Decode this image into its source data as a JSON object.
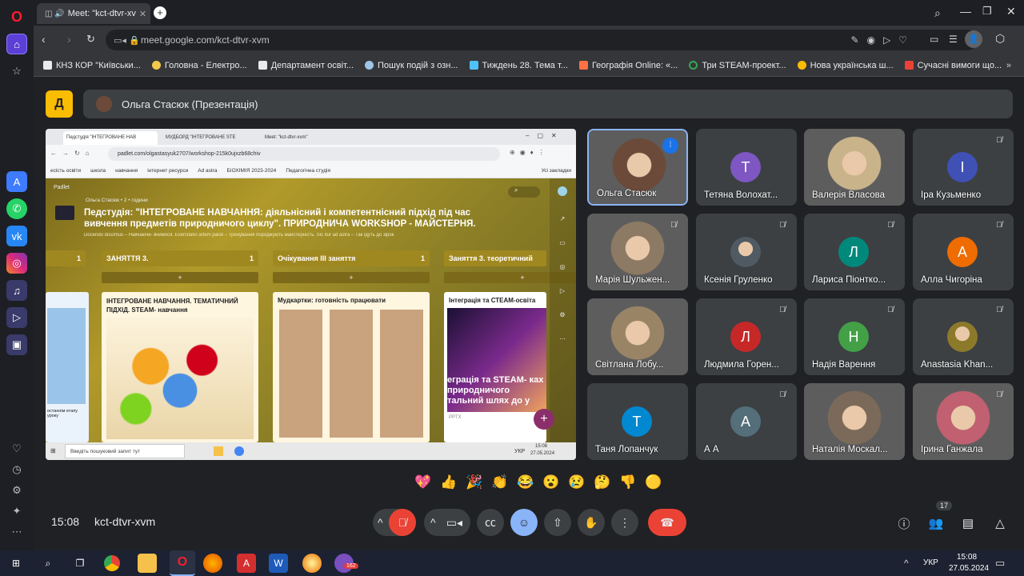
{
  "browser": {
    "tab_title": "Meet: \"kct-dtvr-xv",
    "url": "meet.google.com/kct-dtvr-xvm",
    "bookmarks": [
      {
        "label": "КНЗ КОР \"Київськи...",
        "color": "#e8eaed"
      },
      {
        "label": "Головна - Електро...",
        "color": "#f2c94c"
      },
      {
        "label": "Департамент освіт...",
        "color": "#e8eaed"
      },
      {
        "label": "Пошук подій з озн...",
        "color": "#9fc5e8"
      },
      {
        "label": "Тиждень 28. Тема т...",
        "color": "#4fc3f7"
      },
      {
        "label": "Географія Online: «...",
        "color": "#ff7043"
      },
      {
        "label": "Три STEAM-проект...",
        "color": "#34a853"
      },
      {
        "label": "Нова українська ш...",
        "color": "#fbbc04"
      },
      {
        "label": "Сучасні вимоги що...",
        "color": "#ea4335"
      }
    ]
  },
  "meet": {
    "presenter_label": "Ольга Стасюк (Презентація)",
    "time": "15:08",
    "meeting_code": "kct-dtvr-xvm",
    "people_count": "17",
    "participants": [
      {
        "name": "Ольга Стасюк",
        "initial": "",
        "color": "#6b4a3a",
        "muted": false,
        "photo": true
      },
      {
        "name": "Тетяна Волохат...",
        "initial": "Т",
        "color": "#7e57c2",
        "muted": false,
        "photo": false
      },
      {
        "name": "Валерія Власова",
        "initial": "",
        "color": "#c9b38a",
        "muted": false,
        "photo": true
      },
      {
        "name": "Іра Кузьменко",
        "initial": "І",
        "color": "#3f51b5",
        "muted": true,
        "photo": false
      },
      {
        "name": "Марія Шульжен...",
        "initial": "",
        "color": "#8d7a64",
        "muted": true,
        "photo": true
      },
      {
        "name": "Ксенія Груленко",
        "initial": "",
        "color": "#4f5a63",
        "muted": true,
        "photo": false
      },
      {
        "name": "Лариса Піонтко...",
        "initial": "Л",
        "color": "#00897b",
        "muted": true,
        "photo": false
      },
      {
        "name": "Алла Чигоріна",
        "initial": "А",
        "color": "#ef6c00",
        "muted": true,
        "photo": false
      },
      {
        "name": "Світлана Лобу...",
        "initial": "",
        "color": "#9a8466",
        "muted": false,
        "photo": true
      },
      {
        "name": "Людмила Горен...",
        "initial": "Л",
        "color": "#c62828",
        "muted": true,
        "photo": false
      },
      {
        "name": "Надія Варення",
        "initial": "Н",
        "color": "#43a047",
        "muted": true,
        "photo": false
      },
      {
        "name": "Anastasia Khan...",
        "initial": "",
        "color": "#8c7a2a",
        "muted": true,
        "photo": false
      },
      {
        "name": "Таня Лопанчук",
        "initial": "Т",
        "color": "#0288d1",
        "muted": false,
        "photo": false
      },
      {
        "name": "А А",
        "initial": "А",
        "color": "#546e7a",
        "muted": true,
        "photo": false
      },
      {
        "name": "Наталія Москал...",
        "initial": "",
        "color": "#7b6a5a",
        "muted": false,
        "photo": true
      },
      {
        "name": "Ірина Ганжала",
        "initial": "",
        "color": "#c06070",
        "muted": true,
        "photo": true
      }
    ],
    "reactions": [
      "💖",
      "👍",
      "🎉",
      "👏",
      "😂",
      "😮",
      "😢",
      "🤔",
      "👎",
      "🟡"
    ]
  },
  "shared_screen": {
    "tabs": [
      "Педстудія \"ІНТЕГРОВАНЕ НАВ",
      "МУДБОРД \"ІНТЕГРОВАНЕ STE",
      "Meet: \"kct-dtvr-xvm\""
    ],
    "url": "padlet.com/olgastasyuk2707/workshop-215k0ujxzb68chiv",
    "bookmarks": [
      "есість освіти",
      "школа",
      "навчання",
      "інтернет ресурси",
      "Ad astra",
      "БІОХІМІЯ 2023-2024",
      "Педагогічна студія",
      "Усі закладки"
    ],
    "brand": "Padlet",
    "author": "Ольга Стасюк • 2 • години",
    "title": "Педстудія: \"ІНТЕГРОВАНЕ НАВЧАННЯ: діяльнісний і компетентнісний підхід під час вивчення предметів природничого циклу\". ПРИРОДНИЧА WORKSHOP - МАЙСТЕРНЯ.",
    "subtitle": "Docendo discimus – Навчаючи- вчимося. Exercitatio artem parat – Тренування породжують майстерність. Sic itur ad astra – Так ідуть до зірок",
    "columns": [
      "ЗАНЯТТЯ 3.",
      "Очікування III заняття",
      "Заняття 3. теоретичний"
    ],
    "col_counts": [
      "1",
      "1",
      "1",
      "1"
    ],
    "card1_title": "ІНТЕГРОВАНЕ НАВЧАННЯ. ТЕМАТИЧНИЙ ПІДХІД. STEAM- навчання",
    "card2_title": "Мудкартки: готовність працювати",
    "card3_title": "Інтеграція та СТЕАМ-освіта",
    "card3_overlay": "еграція та STEAM- ках природничого тальний шлях до у",
    "card3_tag": "PPTX",
    "left_card_text": "останнім етапу уроку",
    "taskbar_search": "Введіть пошуковий запит тут",
    "taskbar_lang": "УКР",
    "taskbar_time": "15:08",
    "taskbar_date": "27.05.2024"
  },
  "windows": {
    "lang": "УКР",
    "time": "15:08",
    "date": "27.05.2024",
    "viber_badge": "162"
  }
}
